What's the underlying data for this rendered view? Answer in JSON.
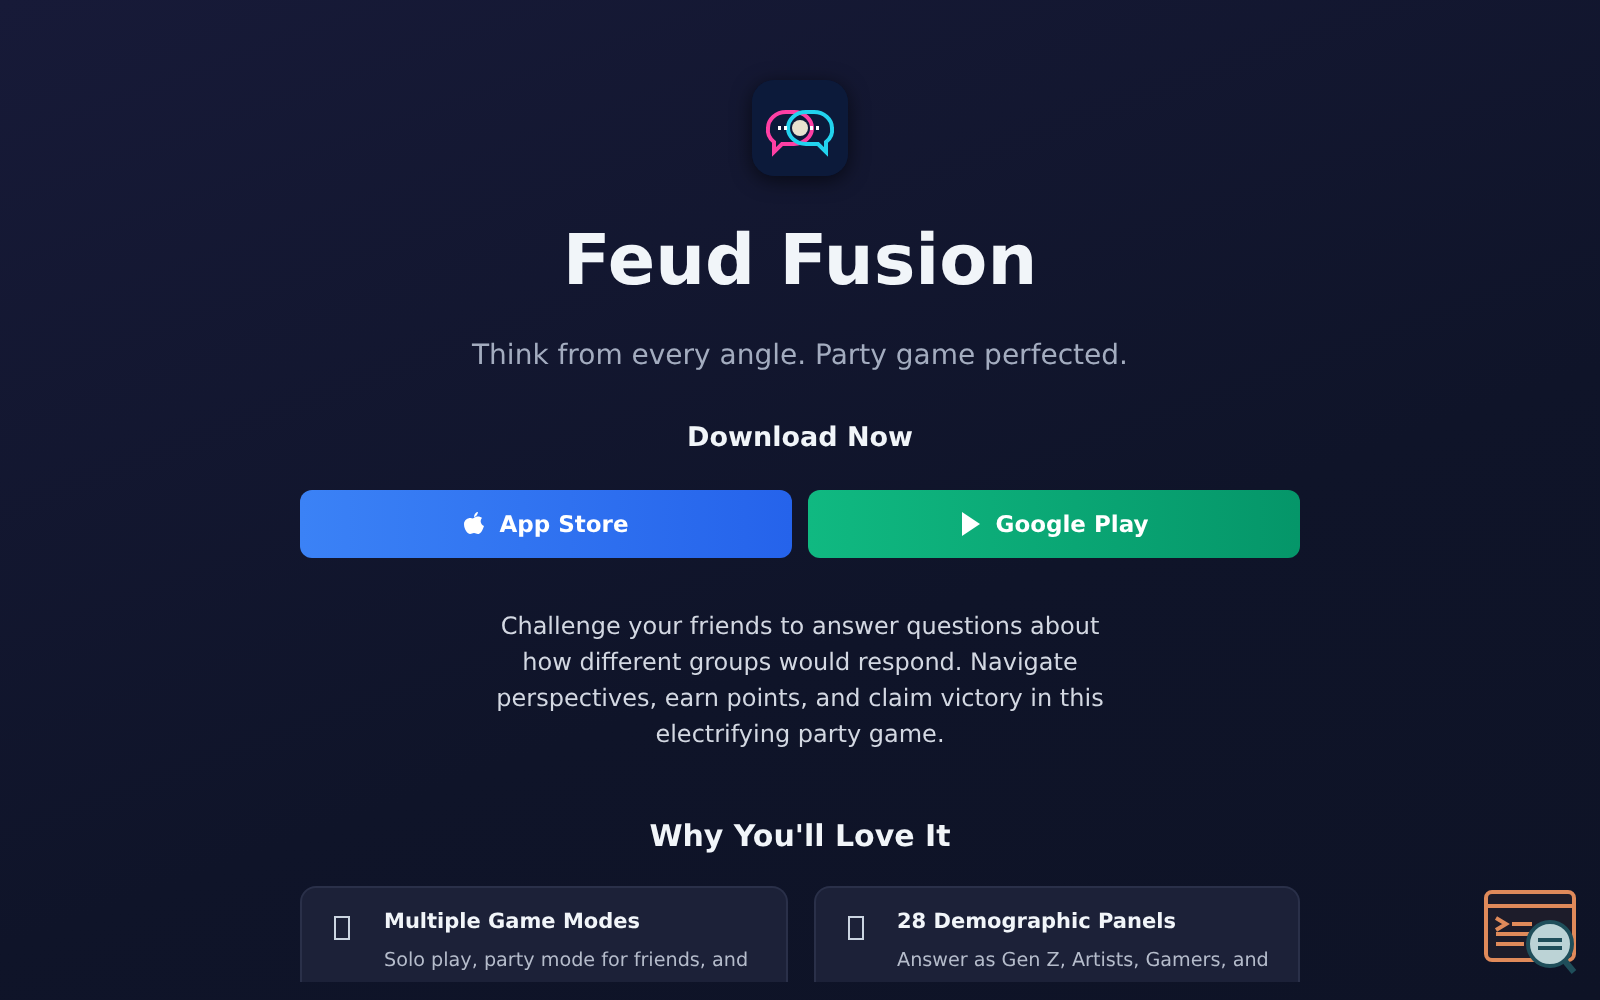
{
  "app": {
    "name": "Feud Fusion",
    "tagline": "Think from every angle. Party game perfected."
  },
  "download": {
    "heading": "Download Now",
    "buttons": [
      {
        "kind": "apple",
        "label": "App Store"
      },
      {
        "kind": "play",
        "label": "Google Play"
      }
    ]
  },
  "description": "Challenge your friends to answer questions about how different groups would respond. Navigate perspectives, earn points, and claim victory in this electrifying party game.",
  "features": {
    "heading": "Why You'll Love It",
    "items": [
      {
        "title": "Multiple Game Modes",
        "text": "Solo play, party mode for friends, and"
      },
      {
        "title": "28 Demographic Panels",
        "text": "Answer as Gen Z, Artists, Gamers, and"
      }
    ]
  }
}
